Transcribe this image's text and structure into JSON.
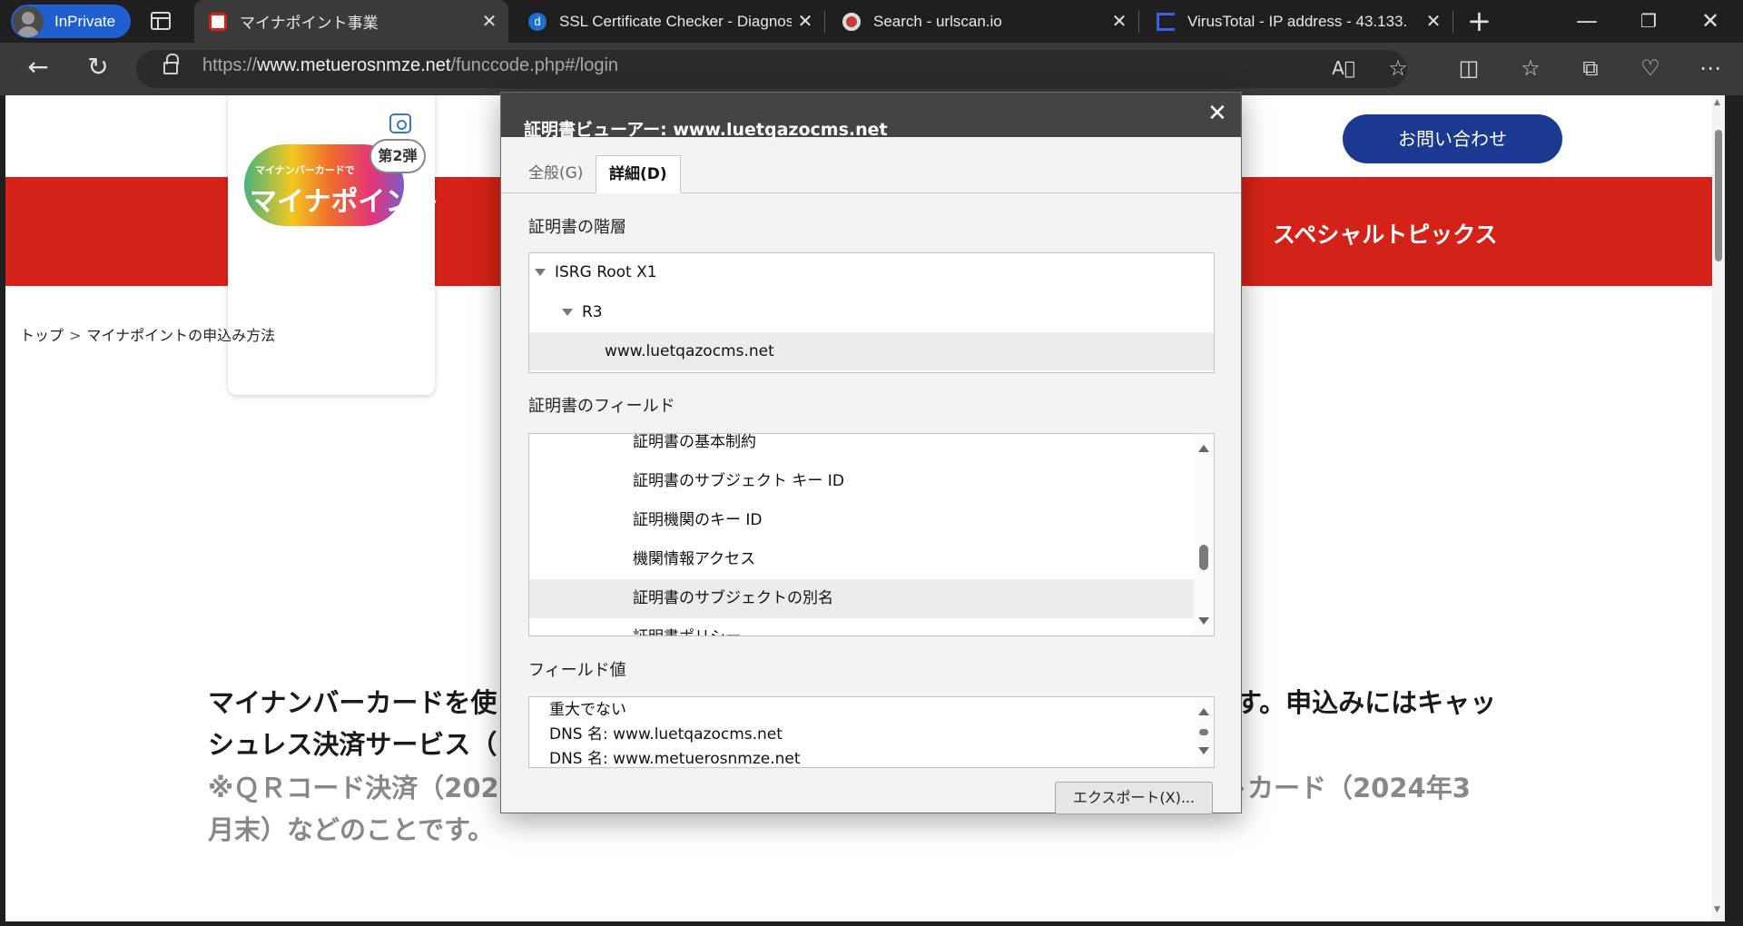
{
  "browser": {
    "inprivate_label": "InPrivate",
    "tabs": [
      {
        "title": "マイナポイント事業",
        "favicon": "minapoint-favicon",
        "color": "#d52218"
      },
      {
        "title": "SSL Certificate Checker - Diagnostic",
        "favicon": "digicert-favicon",
        "color": "#1f6fd1"
      },
      {
        "title": "Search - urlscan.io",
        "favicon": "urlscan-favicon",
        "color": "#c43b3b"
      },
      {
        "title": "VirusTotal - IP address - 43.133.",
        "favicon": "virustotal-favicon",
        "color": "#3b61f0"
      }
    ],
    "close_glyph": "✕",
    "new_tab_glyph": "+",
    "url": {
      "prefix": "https://",
      "domain": "www.metuerosnmze.net",
      "path": "/funccode.php#/login"
    }
  },
  "page": {
    "contact_button": "お問い合わせ",
    "special_topics": "スペシャルトピックス",
    "logo": {
      "small_text": "マイナンバーカードで",
      "main_text": "マイナポイント",
      "badge": "第2弾"
    },
    "breadcrumb": {
      "home": "トップ",
      "separator": ">",
      "current": "マイナポイントの申込み方法"
    },
    "body_line1": "マイナンバーカードを使",
    "body_line1_tail": "す。申込みにはキャッ",
    "body_line2": "シュレス決済サービス（",
    "body_note1": "※ＱＲコード決済（202",
    "body_note1_tail": "トカード（2024年3",
    "body_note2": "月末）などのことです。"
  },
  "dialog": {
    "title": "証明書ビューアー: www.luetqazocms.net",
    "tab_general": "全般(G)",
    "tab_details": "詳細(D)",
    "hierarchy_label": "証明書の階層",
    "hierarchy": [
      "ISRG Root X1",
      "R3",
      "www.luetqazocms.net"
    ],
    "fields_label": "証明書のフィールド",
    "fields": [
      "証明書の基本制約",
      "証明書のサブジェクト キー ID",
      "証明機関のキー ID",
      "機関情報アクセス",
      "証明書のサブジェクトの別名",
      "証明書ポリシー"
    ],
    "value_label": "フィールド値",
    "values": [
      "重大でない",
      "DNS 名: www.luetqazocms.net",
      "DNS 名: www.metuerosnmze.net"
    ],
    "export_button": "エクスポート(X)..."
  }
}
